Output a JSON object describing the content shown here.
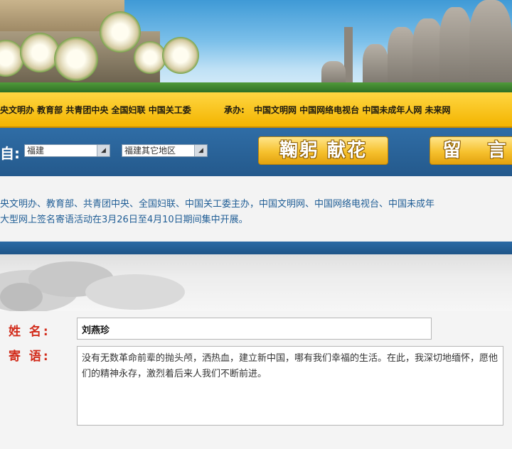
{
  "sponsors": {
    "organizers": "央文明办 教育部 共青团中央 全国妇联 中国关工委",
    "cohost_label": "承办:",
    "cohosts": "中国文明网 中国网络电视台 中国未成年人网 未来网"
  },
  "controls": {
    "from_label": "自:",
    "province_select": "福建",
    "region_select": "福建其它地区",
    "tribute_button": "鞠躬 献花",
    "message_button": "留 言"
  },
  "intro": {
    "line1": "央文明办、教育部、共青团中央、全国妇联、中国关工委主办，中国文明网、中国网络电视台、中国未成年",
    "line2": "大型网上签名寄语活动在3月26日至4月10日期间集中开展。"
  },
  "form": {
    "name_label": "姓 名:",
    "name_value": "刘燕珍",
    "message_label": "寄 语:",
    "message_value": "没有无数革命前辈的抛头颅，洒热血，建立新中国，哪有我们幸福的生活。在此，我深切地缅怀，愿他们的精神永存，激烈着后来人我们不断前进。"
  },
  "colors": {
    "sponsor_bar": "#f3b400",
    "control_bar": "#2f6da6",
    "label_red": "#d22b1a",
    "intro_text": "#1f5d95"
  }
}
